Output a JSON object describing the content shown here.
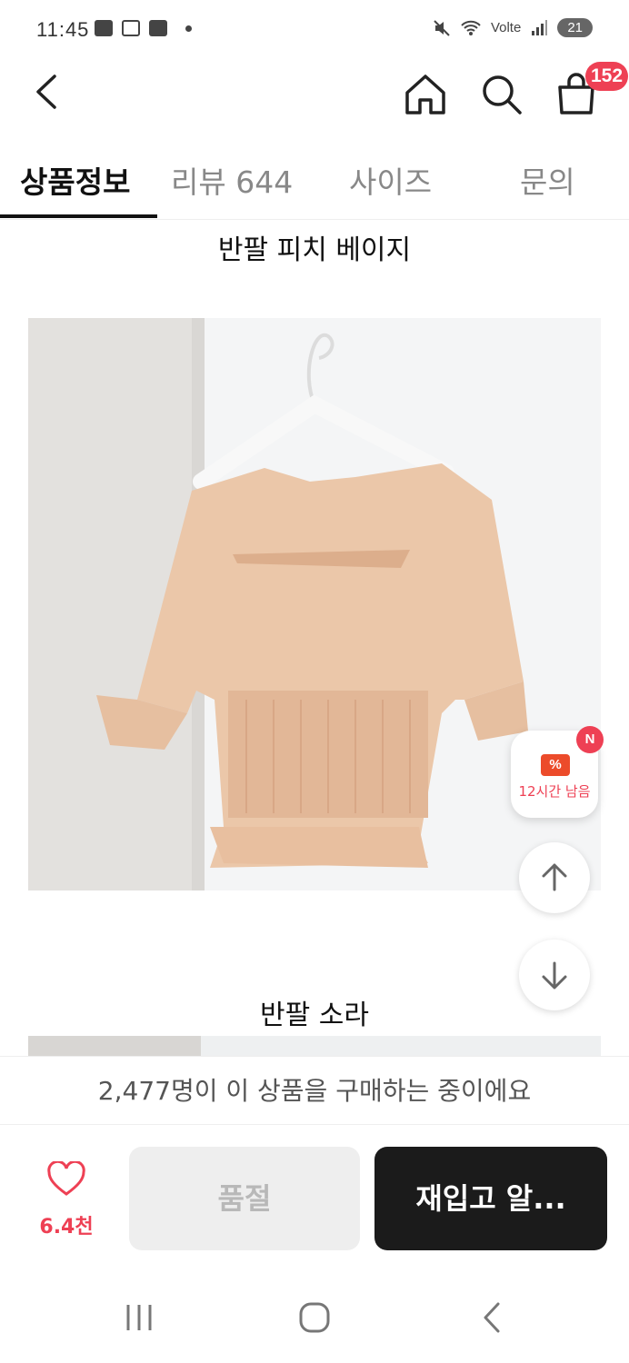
{
  "status_bar": {
    "time": "11:45",
    "network": "Volte",
    "battery": "21"
  },
  "header": {
    "cart_count": "152"
  },
  "tabs": [
    {
      "label": "상품정보",
      "active": true
    },
    {
      "label": "리뷰 644",
      "active": false
    },
    {
      "label": "사이즈",
      "active": false
    },
    {
      "label": "문의",
      "active": false
    }
  ],
  "content": {
    "caption_1": "반팔  피치 베이지",
    "caption_2": "반팔 소라"
  },
  "floating": {
    "coupon_label": "12시간 남음",
    "coupon_badge": "N",
    "coupon_icon_glyph": "%"
  },
  "notice": {
    "text": "2,477명이 이 상품을 구매하는 중이에요"
  },
  "actions": {
    "like_count": "6.4천",
    "soldout_label": "품절",
    "restock_label": "재입고 알..."
  },
  "colors": {
    "accent": "#ee4054",
    "dark_button": "#1b1b1b",
    "disabled_button": "#eeeeee"
  }
}
